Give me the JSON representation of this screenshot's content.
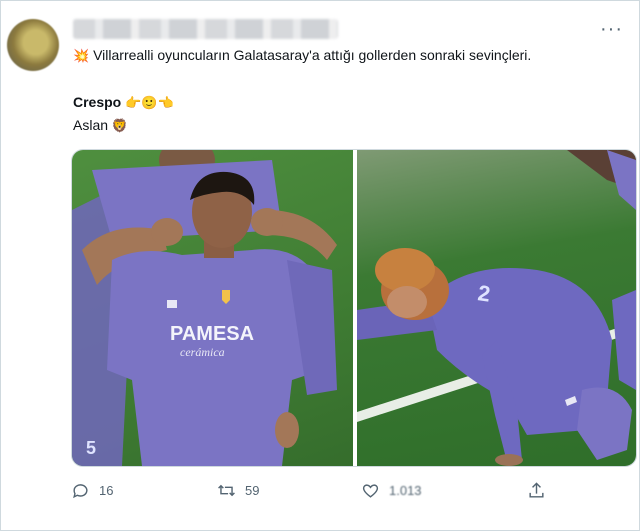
{
  "tweet": {
    "text_line1": "Villarrealli oyuncuların Galatasaray'a attığı gollerden sonraki sevinçleri.",
    "text_line2": "Crespo",
    "text_line2_emoji": "👉🙂👈",
    "text_line3": "Aslan",
    "text_line3_emoji": "🦁",
    "lead_emoji": "💥"
  },
  "media": {
    "panel1_shirt_text": "PAMESA",
    "panel1_shirt_subtext": "cerámica",
    "panel1_number": "5"
  },
  "actions": {
    "replies": "16",
    "retweets": "59",
    "likes": "1.013"
  },
  "colors": {
    "kit_purple": "#7b74c4",
    "pitch_green": "#3f7c33",
    "icon_gray": "#536471"
  }
}
